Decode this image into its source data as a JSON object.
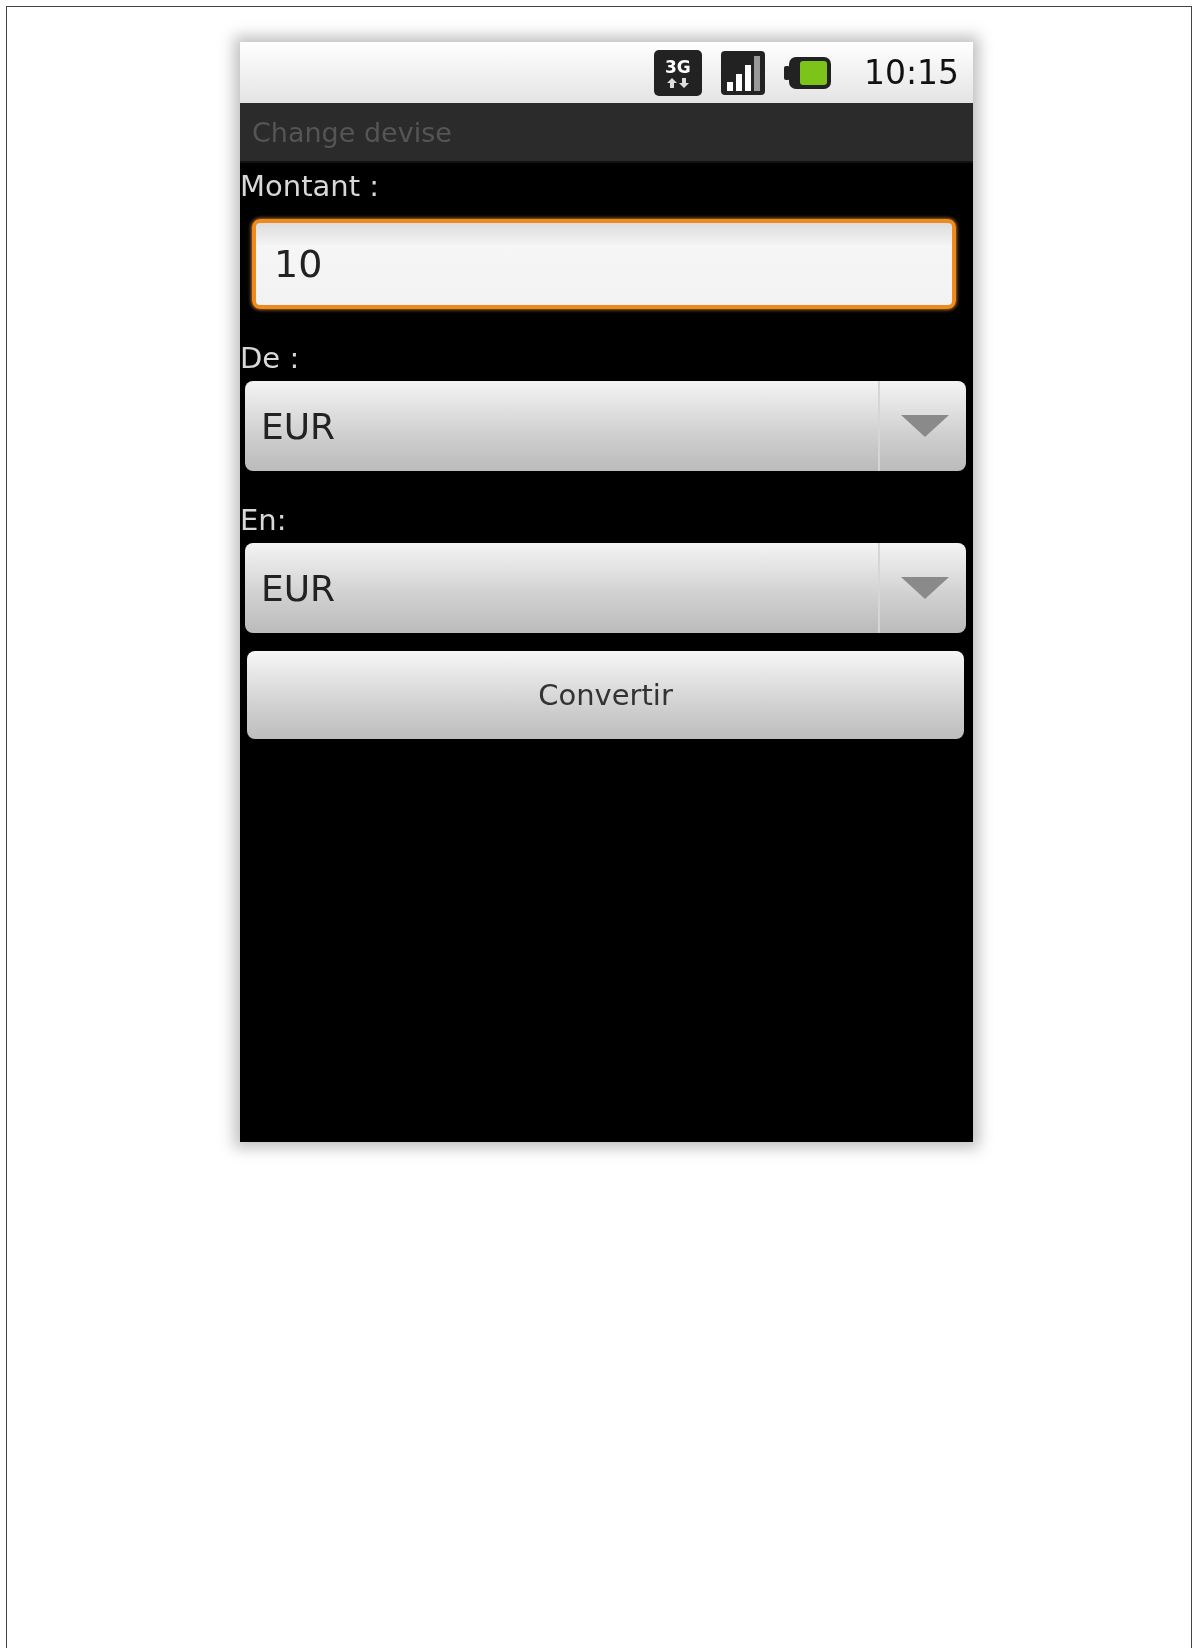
{
  "status_bar": {
    "network": "3G",
    "time": "10:15"
  },
  "title": "Change devise",
  "form": {
    "amount": {
      "label": "Montant :",
      "value": "10",
      "focused": true
    },
    "from": {
      "label": "De :",
      "value": "EUR"
    },
    "to": {
      "label": "En:",
      "value": "EUR"
    }
  },
  "button": {
    "label": "Convertir"
  }
}
